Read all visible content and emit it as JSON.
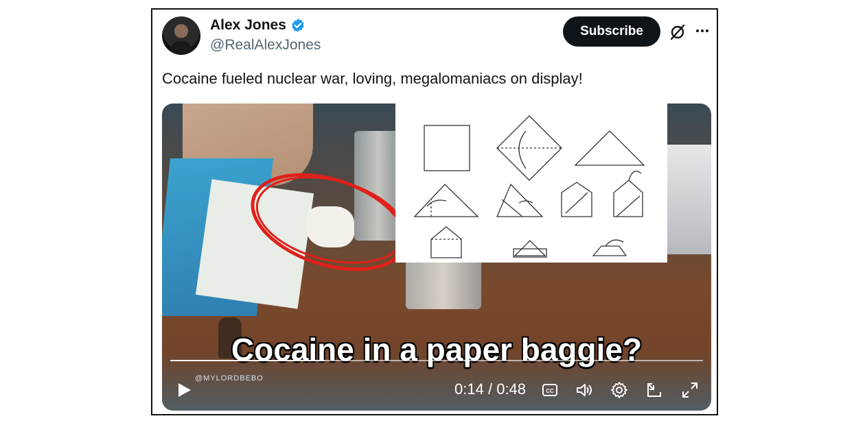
{
  "author": {
    "display_name": "Alex Jones",
    "handle": "@RealAlexJones",
    "verified_icon": "verified-badge-icon"
  },
  "actions": {
    "subscribe_label": "Subscribe",
    "grok_icon": "slashed-circle-icon",
    "more_icon": "more-horizontal-icon"
  },
  "tweet": {
    "text": "Cocaine fueled nuclear war, loving, megalomaniacs on display!"
  },
  "video": {
    "caption": "Cocaine in a paper baggie?",
    "watermark": "@MYLORDBEBO",
    "current_time": "0:14",
    "separator": "/",
    "duration": "0:48",
    "progress_fraction": 0.29,
    "controls": [
      "play-icon",
      "closed-captions-icon",
      "volume-icon",
      "settings-icon",
      "pop-out-icon",
      "fullscreen-icon"
    ]
  },
  "colors": {
    "text_primary": "#0f1419",
    "text_secondary": "#536471",
    "verified_blue": "#1d9bf0",
    "annotation_red": "#e0201a"
  }
}
